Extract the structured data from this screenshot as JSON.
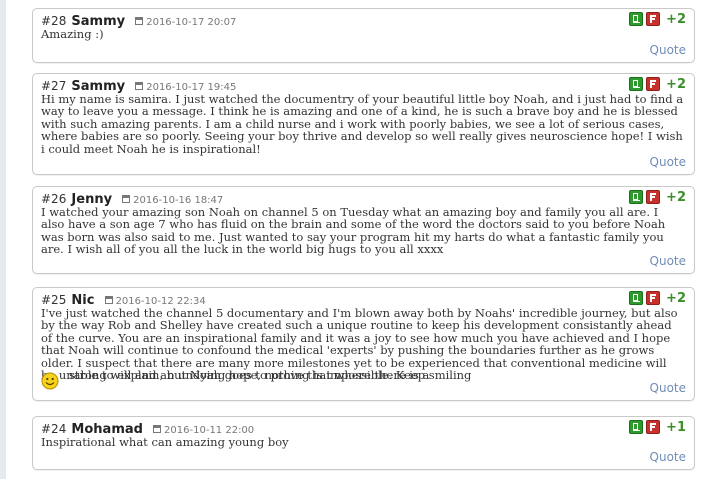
{
  "comments": [
    {
      "number": "#28",
      "author": "Sammy",
      "date": "2016-10-17 20:07",
      "score": "+2",
      "text": "Amazing :)",
      "quote_label": "Quote"
    },
    {
      "number": "#27",
      "author": "Sammy",
      "date": "2016-10-17 19:45",
      "score": "+2",
      "text": "Hi my name is samira. I just watched the documentry of your beautiful little boy Noah, and i just had to find a way to leave you a message. I think he is amazing and one of a kind, he is such a brave boy and he is blessed with such amazing parents. I am a child nurse and i work with poorly babies, we see a lot of serious cases, where babies are so poorly. Seeing your boy thrive and develop so well really gives neuroscience hope! I wish i could meet Noah he is inspirational!",
      "quote_label": "Quote"
    },
    {
      "number": "#26",
      "author": "Jenny",
      "date": "2016-10-16 18:47",
      "score": "+2",
      "text": "I watched your amazing son Noah on channel 5 on Tuesday what an amazing boy and family you all are. I also have a son age 7 who has fluid on the brain and some of the word the doctors said to you before Noah was born was also said to me. Just wanted to say your program hit my harts do what a fantastic family you are. I wish all of you all the luck in the world big hugs to you all xxxx",
      "quote_label": "Quote"
    },
    {
      "number": "#25",
      "author": "Nic",
      "date": "2016-10-12 22:34",
      "score": "+2",
      "text": "I've just watched the channel 5 documentary and I'm blown away both by Noahs' incredible journey, but also by the way Rob and Shelley have created such a unique routine to keep his development consistantly ahead of the curve. You are an inspirational family and it was a joy to see how much you have achieved and I hope that Noah will continue to confound the medical 'experts' by pushing the boundaries further as he grows older. I suspect that there are many more milestones yet to be experienced that conventional medicine will be unable to explain, but Noah goes to prove that where there is a",
      "text_continued": "strong will and an undying hope, nothing is impossible. Keep smiling",
      "quote_label": "Quote"
    },
    {
      "number": "#24",
      "author": "Mohamad",
      "date": "2016-10-11 22:00",
      "score": "+1",
      "text": "Inspirational what can amazing young boy",
      "quote_label": "Quote"
    }
  ],
  "colors": {
    "vote_up": "#2e9a2e",
    "vote_down": "#c8302b",
    "score": "#3a8f2a",
    "quote_link": "#6f8db6",
    "border": "#c9c9c9"
  },
  "icons": {
    "vote_up": "thumbs-up-icon",
    "vote_down": "thumbs-down-icon",
    "date": "calendar-icon",
    "emoticon": "smiley-icon"
  }
}
